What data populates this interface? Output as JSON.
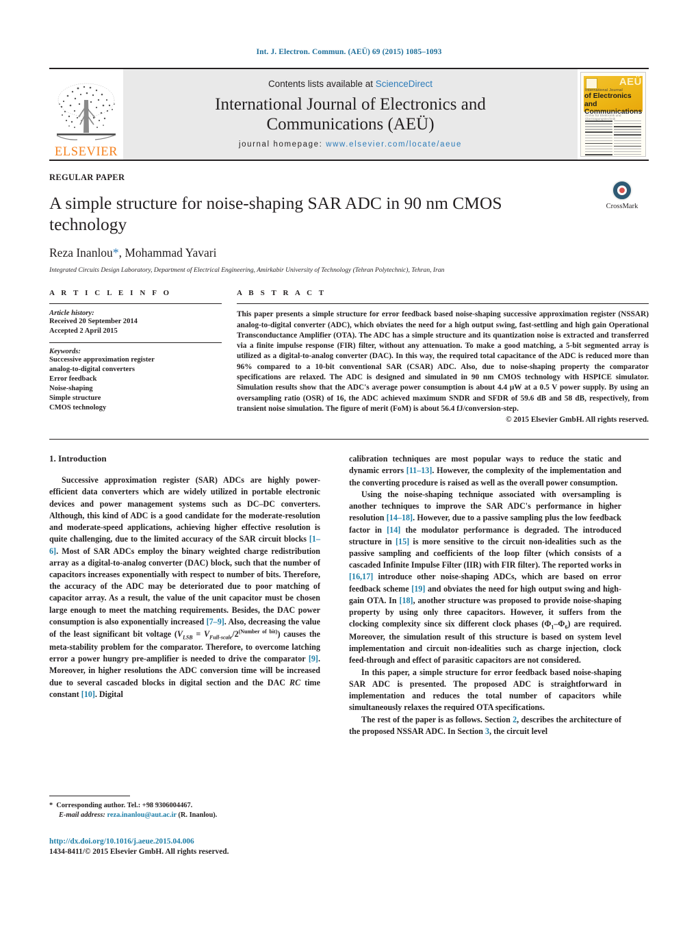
{
  "running_head": "Int. J. Electron. Commun. (AEÜ) 69 (2015) 1085–1093",
  "masthead": {
    "publisher_name": "ELSEVIER",
    "contents_prefix": "Contents lists available at ",
    "contents_link": "ScienceDirect",
    "journal_title_line1": "International Journal of Electronics and",
    "journal_title_line2": "Communications (AEÜ)",
    "homepage_label": "journal homepage:",
    "homepage_url": "www.elsevier.com/locate/aeue",
    "cover": {
      "logo_text": "AEÜ",
      "line_small": "International Journal",
      "line1": "of Electronics and",
      "line2": "Communications",
      "subline": "Archiv für Elektronik und Übertragungstechnik"
    }
  },
  "article_type": "REGULAR PAPER",
  "title": "A simple structure for noise-shaping SAR ADC in 90 nm CMOS technology",
  "authors_prefix": "Reza Inanlou",
  "authors_star": "*",
  "authors_suffix": ", Mohammad Yavari",
  "affiliation": "Integrated Circuits Design Laboratory, Department of Electrical Engineering, Amirkabir University of Technology (Tehran Polytechnic), Tehran, Iran",
  "crossmark_label": "CrossMark",
  "article_info": {
    "heading": "A R T I C L E   I N F O",
    "history_label": "Article history:",
    "received": "Received 20 September 2014",
    "accepted": "Accepted 2 April 2015",
    "keywords_label": "Keywords:",
    "keywords": [
      "Successive approximation register",
      "analog-to-digital converters",
      "Error feedback",
      "Noise-shaping",
      "Simple structure",
      "CMOS technology"
    ]
  },
  "abstract": {
    "heading": "A B S T R A C T",
    "text": "This paper presents a simple structure for error feedback based noise-shaping successive approximation register (NSSAR) analog-to-digital converter (ADC), which obviates the need for a high output swing, fast-settling and high gain Operational Transconductance Amplifier (OTA). The ADC has a simple structure and its quantization noise is extracted and transferred via a finite impulse response (FIR) filter, without any attenuation. To make a good matching, a 5-bit segmented array is utilized as a digital-to-analog converter (DAC). In this way, the required total capacitance of the ADC is reduced more than 96% compared to a 10-bit conventional SAR (CSAR) ADC. Also, due to noise-shaping property the comparator specifications are relaxed. The ADC is designed and simulated in 90 nm CMOS technology with HSPICE simulator. Simulation results show that the ADC's average power consumption is about 4.4 μW at a 0.5 V power supply. By using an oversampling ratio (OSR) of 16, the ADC achieved maximum SNDR and SFDR of 59.6 dB and 58 dB, respectively, from transient noise simulation. The figure of merit (FoM) is about 56.4 fJ/conversion-step.",
    "copyright": "© 2015 Elsevier GmbH. All rights reserved."
  },
  "section": {
    "number_title": "1.  Introduction"
  },
  "body": {
    "left_p1_a": "Successive approximation register (SAR) ADCs are highly power-efficient data converters which are widely utilized in portable electronic devices and power management systems such as DC–DC converters. Although, this kind of ADC is a good candidate for the moderate-resolution and moderate-speed applications, achieving higher effective resolution is quite challenging, due to the limited accuracy of the SAR circuit blocks ",
    "left_ref1": "[1–6]",
    "left_p1_b": ". Most of SAR ADCs employ the binary weighted charge redistribution array as a digital-to-analog converter (DAC) block, such that the number of capacitors increases exponentially with respect to number of bits. Therefore, the accuracy of the ADC may be deteriorated due to poor matching of capacitor array. As a result, the value of the unit capacitor must be chosen large enough to meet the matching requirements. Besides, the DAC power consumption is also exponentially increased ",
    "left_ref2": "[7–9]",
    "left_p1_c": ". Also, decreasing the value of the least significant bit voltage (",
    "left_formula_v": "V",
    "left_formula_lsb": "LSB",
    "left_formula_eq": " = ",
    "left_formula_v2": "V",
    "left_formula_fs": "Full-scale",
    "left_formula_div": "/2",
    "left_formula_exp": "(Number of bit)",
    "left_p1_d": ") causes the meta-stability problem for the comparator. Therefore, to overcome latching error a power hungry pre-amplifier is needed to drive the comparator ",
    "left_ref3": "[9]",
    "left_p1_e": ". Moreover, in higher resolutions the ADC conversion time will be increased due to several cascaded blocks in digital section and the DAC ",
    "left_rc": "RC",
    "left_p1_f": " time constant ",
    "left_ref4": "[10]",
    "left_p1_g": ". Digital",
    "right_p1_a": "calibration techniques are most popular ways to reduce the static and dynamic errors ",
    "right_ref1": "[11–13]",
    "right_p1_b": ". However, the complexity of the implementation and the converting procedure is raised as well as the overall power consumption.",
    "right_p2_a": "Using the noise-shaping technique associated with oversampling is another techniques to improve the SAR ADC's performance in higher resolution ",
    "right_ref2": "[14–18]",
    "right_p2_b": ". However, due to a passive sampling plus the low feedback factor in ",
    "right_ref3": "[14]",
    "right_p2_c": " the modulator performance is degraded. The introduced structure in ",
    "right_ref4": "[15]",
    "right_p2_d": " is more sensitive to the circuit non-idealities such as the passive sampling and coefficients of the loop filter (which consists of a cascaded Infinite Impulse Filter (IIR) with FIR filter). The reported works in ",
    "right_ref5": "[16,17]",
    "right_p2_e": " introduce other noise-shaping ADCs, which are based on error feedback scheme ",
    "right_ref6": "[19]",
    "right_p2_f": " and obviates the need for high output swing and high-gain OTA. In ",
    "right_ref7": "[18]",
    "right_p2_g": ", another structure was proposed to provide noise-shaping property by using only three capacitors. However, it suffers from the clocking complexity since six different clock phases (Φ",
    "right_phi1": "1",
    "right_phi_dash": "–Φ",
    "right_phi6": "6",
    "right_p2_h": ") are required. Moreover, the simulation result of this structure is based on system level implementation and circuit non-idealities such as charge injection, clock feed-through and effect of parasitic capacitors are not considered.",
    "right_p3": "In this paper, a simple structure for error feedback based noise-shaping SAR ADC is presented. The proposed ADC is straightforward in implementation and reduces the total number of capacitors while simultaneously relaxes the required OTA specifications.",
    "right_p4_a": "The rest of the paper is as follows. Section ",
    "right_sec2": "2",
    "right_p4_b": ", describes the architecture of the proposed NSSAR ADC. In Section ",
    "right_sec3": "3",
    "right_p4_c": ", the circuit level"
  },
  "footnote": {
    "star": "*",
    "corresponding": "Corresponding author. Tel.: +98 9306004467.",
    "email_label": "E-mail address:",
    "email": "reza.inanlou@aut.ac.ir",
    "email_suffix": " (R. Inanlou)."
  },
  "doi": "http://dx.doi.org/10.1016/j.aeue.2015.04.006",
  "issn_line": "1434-8411/© 2015 Elsevier GmbH. All rights reserved.",
  "colors": {
    "link": "#2b7bb9",
    "reference": "#1f7fa8",
    "elsevier_orange": "#f58220",
    "running_head": "#1f6f9a",
    "masthead_bg": "#e9e9e9"
  }
}
